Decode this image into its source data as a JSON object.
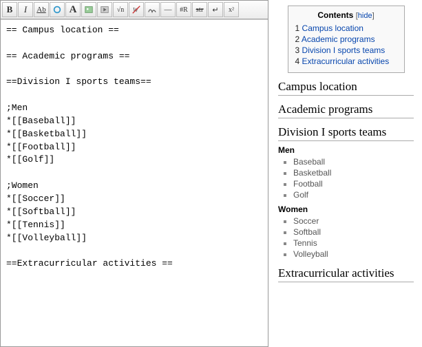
{
  "toolbar": {
    "bold": "B",
    "italic": "I",
    "underline": "Ab",
    "link": "link-icon",
    "heading": "A",
    "image": "image-icon",
    "media": "media-icon",
    "math": "√n",
    "nowiki": "nowiki-icon",
    "sig": "sig-icon",
    "hr": "—",
    "redirect": "#R",
    "strike": "str",
    "linebreak": "↵",
    "sup": "x²"
  },
  "editor_text": "== Campus location ==\n\n== Academic programs ==\n\n==Division I sports teams==\n\n;Men\n*[[Baseball]]\n*[[Basketball]]\n*[[Football]]\n*[[Golf]]\n\n;Women\n*[[Soccer]]\n*[[Softball]]\n*[[Tennis]]\n*[[Volleyball]]\n\n==Extracurricular activities ==",
  "toc": {
    "title": "Contents",
    "hide_label": "hide",
    "items": [
      {
        "num": "1",
        "label": "Campus location"
      },
      {
        "num": "2",
        "label": "Academic programs"
      },
      {
        "num": "3",
        "label": "Division I sports teams"
      },
      {
        "num": "4",
        "label": "Extracurricular activities"
      }
    ]
  },
  "sections": {
    "s1": "Campus location",
    "s2": "Academic programs",
    "s3": "Division I sports teams",
    "s4": "Extracurricular activities"
  },
  "lists": {
    "men_label": "Men",
    "men": [
      "Baseball",
      "Basketball",
      "Football",
      "Golf"
    ],
    "women_label": "Women",
    "women": [
      "Soccer",
      "Softball",
      "Tennis",
      "Volleyball"
    ]
  }
}
